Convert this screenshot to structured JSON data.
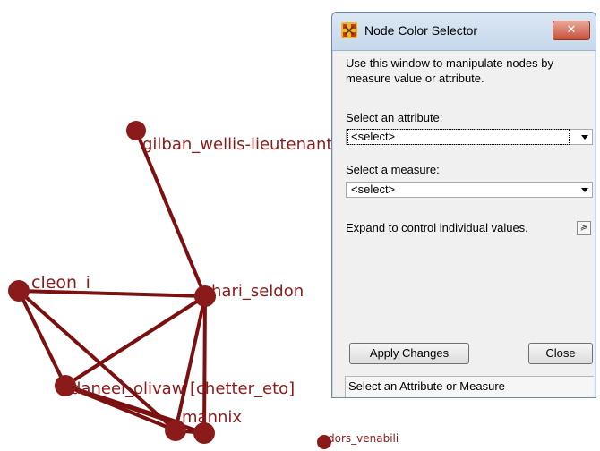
{
  "graph": {
    "nodes": [
      {
        "id": "gilban",
        "label": "gilban_wellis-lieutenant"
      },
      {
        "id": "cleon",
        "label": "cleon_i"
      },
      {
        "id": "hari",
        "label": "hari_seldon"
      },
      {
        "id": "daneel",
        "label": "daneel_olivaw"
      },
      {
        "id": "chetter",
        "label": "[chetter_eto]"
      },
      {
        "id": "mannix",
        "label": "mannix"
      },
      {
        "id": "dors",
        "label": "dors_venabili"
      }
    ],
    "colors": {
      "node": "#8b1a1a",
      "edge": "#7a1010"
    }
  },
  "dialog": {
    "title": "Node Color Selector",
    "close_glyph": "✕",
    "description": "Use this window to manipulate nodes by measure value or attribute.",
    "attribute_label": "Select an attribute:",
    "attribute_value": "<select>",
    "measure_label": "Select a measure:",
    "measure_value": "<select>",
    "expand_label": "Expand to control individual values.",
    "expand_glyph": "≽",
    "apply_button": "Apply Changes",
    "close_button": "Close",
    "status": "Select an Attribute or Measure"
  }
}
